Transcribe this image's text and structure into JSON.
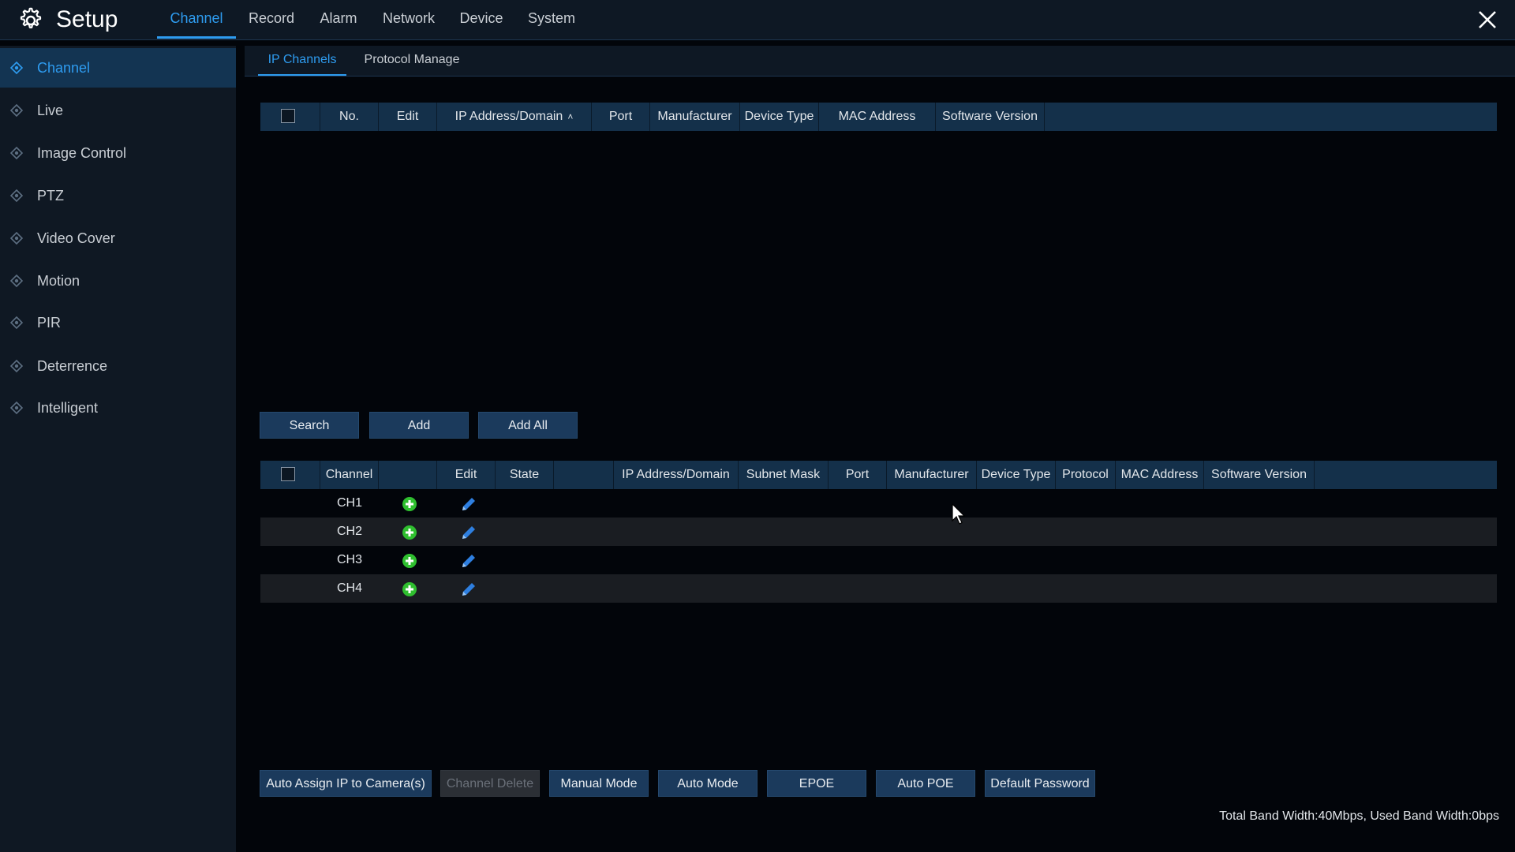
{
  "app": {
    "title": "Setup",
    "logo_icon": "gear-icon",
    "close_icon": "close-icon"
  },
  "main_tabs": [
    {
      "label": "Channel",
      "active": true
    },
    {
      "label": "Record"
    },
    {
      "label": "Alarm"
    },
    {
      "label": "Network"
    },
    {
      "label": "Device"
    },
    {
      "label": "System"
    }
  ],
  "sidebar": {
    "items": [
      {
        "label": "Channel",
        "active": true
      },
      {
        "label": "Live"
      },
      {
        "label": "Image Control"
      },
      {
        "label": "PTZ"
      },
      {
        "label": "Video Cover"
      },
      {
        "label": "Motion"
      },
      {
        "label": "PIR"
      },
      {
        "label": "Deterrence"
      },
      {
        "label": "Intelligent"
      }
    ]
  },
  "sub_tabs": [
    {
      "label": "IP Channels",
      "active": true
    },
    {
      "label": "Protocol Manage"
    }
  ],
  "search_table": {
    "columns": [
      "No.",
      "Edit",
      "IP Address/Domain",
      "Port",
      "Manufacturer",
      "Device Type",
      "MAC Address",
      "Software Version"
    ],
    "sorted_column": "IP Address/Domain",
    "sort_icon": "chevron-up-icon",
    "rows": []
  },
  "search_buttons": {
    "search": "Search",
    "add": "Add",
    "add_all": "Add All"
  },
  "channel_table": {
    "columns": [
      "Channel",
      "",
      "Edit",
      "State",
      "",
      "IP Address/Domain",
      "Subnet Mask",
      "Port",
      "Manufacturer",
      "Device Type",
      "Protocol",
      "MAC Address",
      "Software Version"
    ],
    "rows": [
      {
        "channel": "CH1",
        "add_icon": "plus-circle-icon",
        "edit_icon": "pencil-icon"
      },
      {
        "channel": "CH2",
        "add_icon": "plus-circle-icon",
        "edit_icon": "pencil-icon"
      },
      {
        "channel": "CH3",
        "add_icon": "plus-circle-icon",
        "edit_icon": "pencil-icon"
      },
      {
        "channel": "CH4",
        "add_icon": "plus-circle-icon",
        "edit_icon": "pencil-icon"
      }
    ]
  },
  "bottom_buttons": {
    "auto_assign": "Auto Assign IP to Camera(s)",
    "channel_delete": "Channel Delete",
    "manual_mode": "Manual Mode",
    "auto_mode": "Auto Mode",
    "epoe": "EPOE",
    "auto_poe": "Auto POE",
    "default_password": "Default Password"
  },
  "status": {
    "bandwidth": "Total Band Width:40Mbps, Used Band Width:0bps"
  },
  "colors": {
    "accent": "#2e9cf0",
    "header_bg": "#14304a",
    "sidebar_bg": "#0f1823",
    "add_green": "#2fbf2f",
    "edit_blue": "#2e7fe0"
  }
}
